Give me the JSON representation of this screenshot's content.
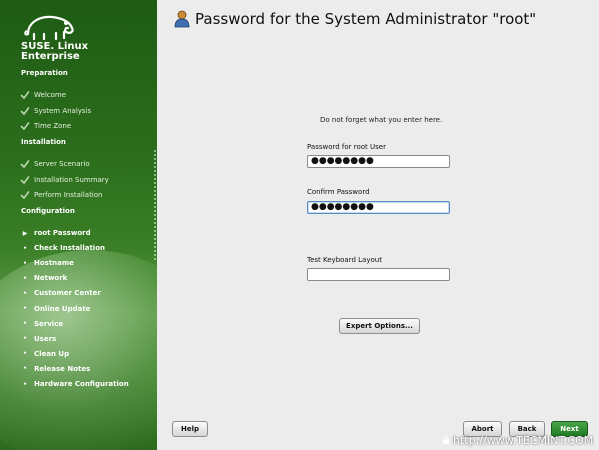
{
  "sidebar": {
    "brand_line1": "SUSE. Linux",
    "brand_line2": "Enterprise",
    "sections": {
      "preparation": "Preparation",
      "installation": "Installation",
      "configuration": "Configuration"
    },
    "preparation_steps": [
      "Welcome",
      "System Analysis",
      "Time Zone"
    ],
    "installation_steps": [
      "Server Scenario",
      "Installation Summary",
      "Perform Installation"
    ],
    "configuration_steps": [
      "root Password",
      "Check Installation",
      "Hostname",
      "Network",
      "Customer Center",
      "Online Update",
      "Service",
      "Users",
      "Clean Up",
      "Release Notes",
      "Hardware Configuration"
    ],
    "current_marker": "▶",
    "pending_marker": "•"
  },
  "main": {
    "title": "Password for the System Administrator \"root\"",
    "note": "Do not forget what you enter here.",
    "password_label": "Password for root User",
    "password_value": "●●●●●●●●",
    "confirm_label": "Confirm Password",
    "confirm_value": "●●●●●●●●",
    "keyboard_label": "Test Keyboard Layout",
    "keyboard_value": "",
    "expert_button": "Expert Options..."
  },
  "footer": {
    "help": "Help",
    "abort": "Abort",
    "back": "Back",
    "next": "Next"
  },
  "watermark": "http://www.TECMINT.COM",
  "colors": {
    "sidebar_green": "#2b6e1c",
    "next_button": "#1f7a24",
    "background": "#ececec"
  }
}
